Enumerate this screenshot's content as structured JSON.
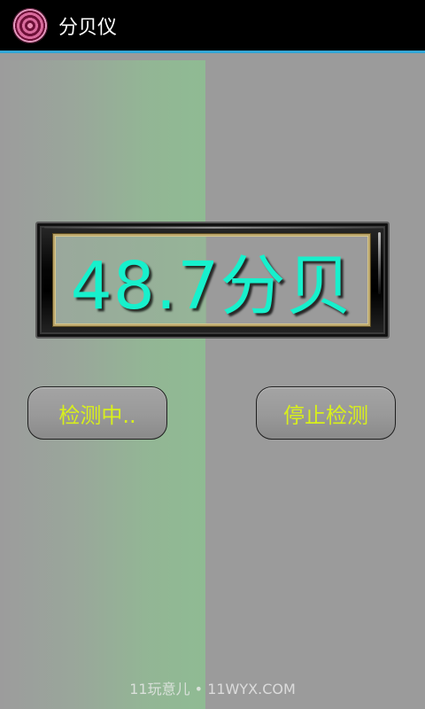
{
  "action_bar": {
    "title": "分贝仪",
    "icon": "decibel-app-icon"
  },
  "meter": {
    "reading": "48.7分贝"
  },
  "buttons": {
    "start_label": "检测中..",
    "stop_label": "停止检测"
  },
  "watermark": {
    "text": "11玩意儿 • 11WYX.COM"
  },
  "colors": {
    "action_bar_bg": "#000000",
    "divider": "#33a6d6",
    "content_bg": "#9b9b9b",
    "green_strip": "#8fbb93",
    "meter_text": "#17f0cc",
    "button_text": "#d8ef1c"
  }
}
